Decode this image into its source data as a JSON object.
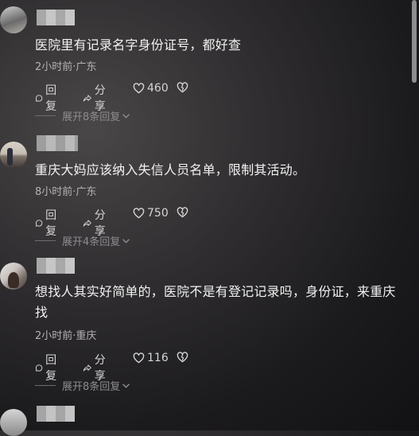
{
  "comments": [
    {
      "text": "医院里有记录名字身份证号，都好查",
      "meta": "2小时前·广东",
      "reply_label": "回复",
      "share_label": "分享",
      "likes": "460",
      "expand": "展开8条回复"
    },
    {
      "text": "重庆大妈应该纳入失信人员名单，限制其活动。",
      "meta": "8小时前·广东",
      "reply_label": "回复",
      "share_label": "分享",
      "likes": "750",
      "expand": "展开4条回复"
    },
    {
      "text": "想找人其实好简单的，医院不是有登记记录吗，身份证，来重庆找",
      "meta": "2小时前·重庆",
      "reply_label": "回复",
      "share_label": "分享",
      "likes": "116",
      "expand": "展开8条回复"
    }
  ],
  "icons": {
    "reply": "comment-bubble-icon",
    "share": "share-arrow-icon",
    "like": "heart-icon",
    "dislike": "broken-heart-icon",
    "expand": "chevron-down-icon"
  }
}
